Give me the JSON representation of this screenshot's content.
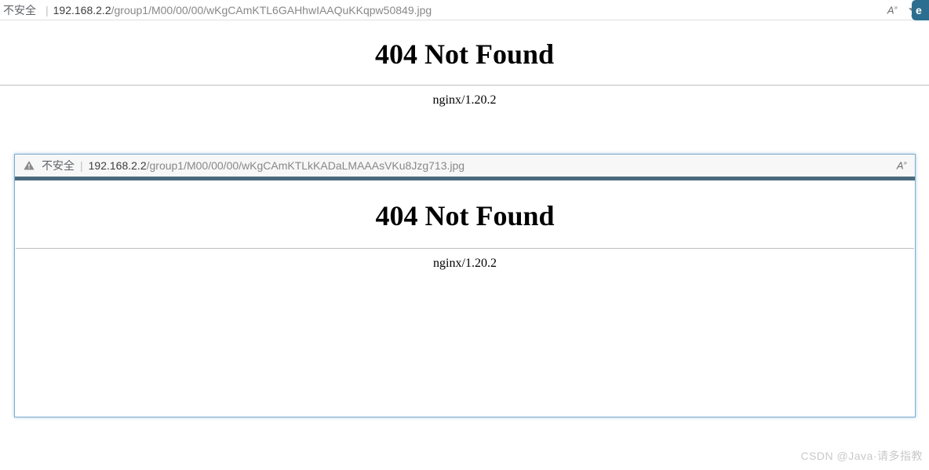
{
  "outer": {
    "not_secure_label": "不安全",
    "separator": "|",
    "url_host": "192.168.2.2",
    "url_path": "/group1/M00/00/00/wKgCAmKTL6GAHhwIAAQuKKqpw50849.jpg",
    "read_aloud": "A",
    "edge_label": "e",
    "heading": "404 Not Found",
    "server": "nginx/1.20.2"
  },
  "inner": {
    "not_secure_label": "不安全",
    "separator": "|",
    "url_host": "192.168.2.2",
    "url_path": "/group1/M00/00/00/wKgCAmKTLkKADaLMAAAsVKu8Jzg713.jpg",
    "read_aloud": "A",
    "heading": "404 Not Found",
    "server": "nginx/1.20.2"
  },
  "watermark": "CSDN @Java·请多指教"
}
